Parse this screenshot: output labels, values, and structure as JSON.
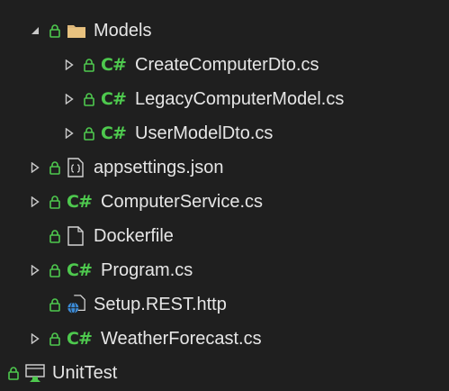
{
  "colors": {
    "background": "#1f1f1f",
    "text": "#e6e6e6",
    "lock": "#4ec94e",
    "csharp": "#4ec94e",
    "folder": "#dcb67a",
    "arrow": "#c8c8c8"
  },
  "tree": {
    "items": [
      {
        "label": "Models",
        "icon": "folder-icon",
        "expander": "expanded"
      },
      {
        "label": "CreateComputerDto.cs",
        "icon": "csharp-file-icon",
        "glyph": "C#",
        "expander": "collapsed"
      },
      {
        "label": "LegacyComputerModel.cs",
        "icon": "csharp-file-icon",
        "glyph": "C#",
        "expander": "collapsed"
      },
      {
        "label": "UserModelDto.cs",
        "icon": "csharp-file-icon",
        "glyph": "C#",
        "expander": "collapsed"
      },
      {
        "label": "appsettings.json",
        "icon": "json-file-icon",
        "expander": "collapsed"
      },
      {
        "label": "ComputerService.cs",
        "icon": "csharp-file-icon",
        "glyph": "C#",
        "expander": "collapsed"
      },
      {
        "label": "Dockerfile",
        "icon": "generic-file-icon",
        "expander": "none"
      },
      {
        "label": "Program.cs",
        "icon": "csharp-file-icon",
        "glyph": "C#",
        "expander": "collapsed"
      },
      {
        "label": "Setup.REST.http",
        "icon": "http-file-icon",
        "expander": "none"
      },
      {
        "label": "WeatherForecast.cs",
        "icon": "csharp-file-icon",
        "glyph": "C#",
        "expander": "collapsed"
      },
      {
        "label": "UnitTest",
        "icon": "test-project-icon",
        "expander": "none"
      }
    ]
  }
}
